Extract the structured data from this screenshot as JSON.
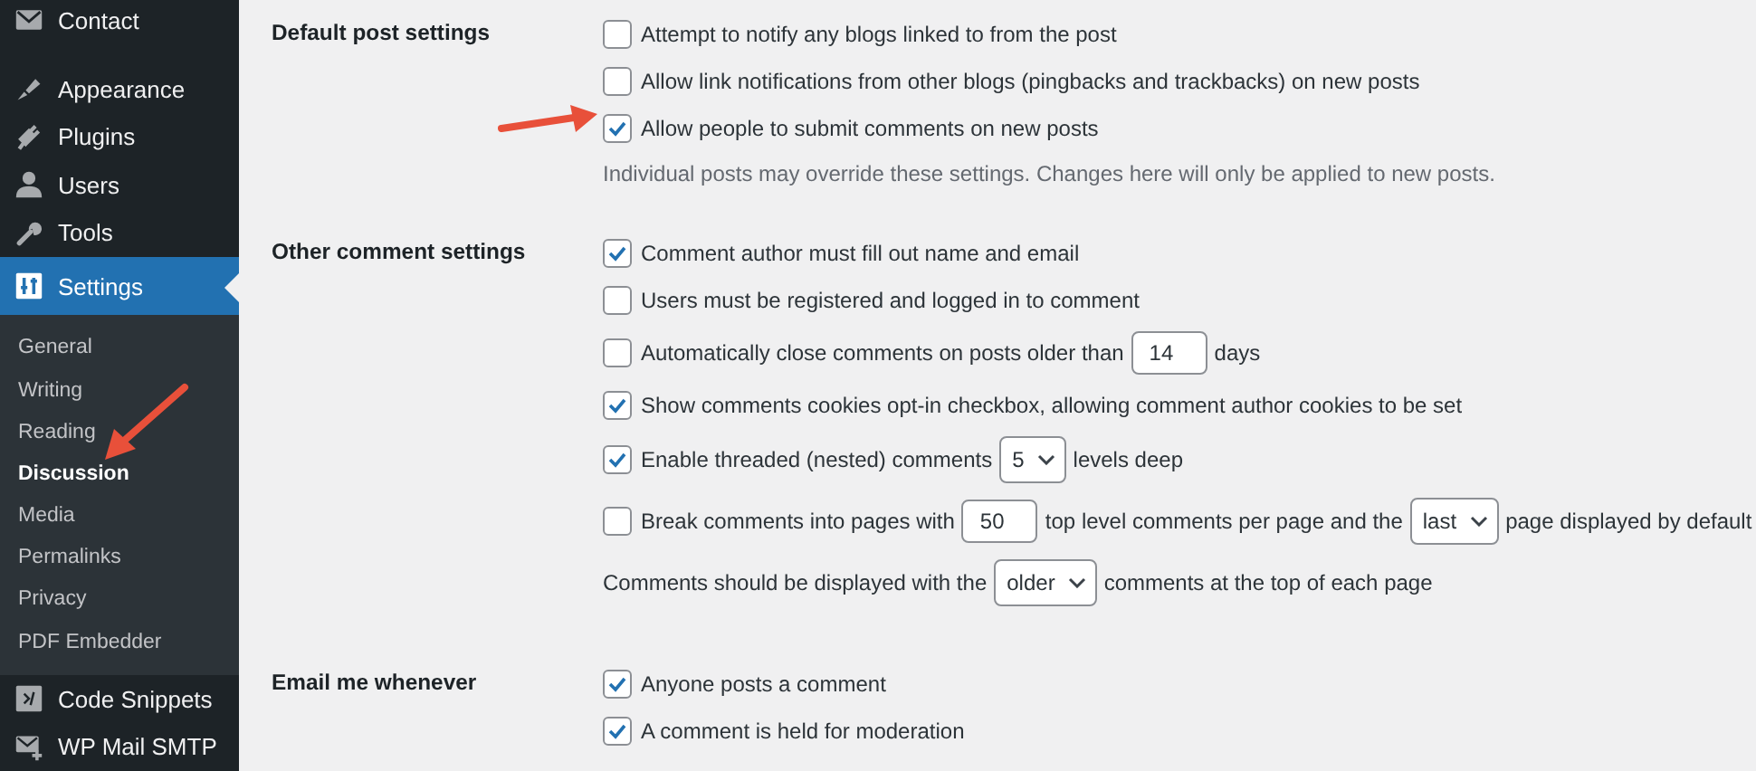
{
  "sidebar": {
    "items": [
      {
        "label": "Contact",
        "kind": "envelope",
        "selected": false
      },
      {
        "label": "Appearance",
        "kind": "brush",
        "selected": false
      },
      {
        "label": "Plugins",
        "kind": "plug",
        "selected": false
      },
      {
        "label": "Users",
        "kind": "user",
        "selected": false
      },
      {
        "label": "Tools",
        "kind": "wrench",
        "selected": false
      },
      {
        "label": "Settings",
        "kind": "sliders",
        "selected": true,
        "children": [
          {
            "label": "General",
            "selected": false
          },
          {
            "label": "Writing",
            "selected": false
          },
          {
            "label": "Reading",
            "selected": false
          },
          {
            "label": "Discussion",
            "selected": true
          },
          {
            "label": "Media",
            "selected": false
          },
          {
            "label": "Permalinks",
            "selected": false
          },
          {
            "label": "Privacy",
            "selected": false
          },
          {
            "label": "PDF Embedder",
            "selected": false
          }
        ]
      },
      {
        "label": "Code Snippets",
        "kind": "code",
        "selected": false
      },
      {
        "label": "WP Mail SMTP",
        "kind": "mail-plus",
        "selected": false
      }
    ]
  },
  "sections": [
    {
      "title": "Default post settings",
      "options": [
        {
          "kind": "checkbox",
          "checked": false,
          "parts": [
            {
              "kind": "text",
              "text": "Attempt to notify any blogs linked to from the post"
            }
          ]
        },
        {
          "kind": "checkbox",
          "checked": false,
          "parts": [
            {
              "kind": "text",
              "text": "Allow link notifications from other blogs (pingbacks and trackbacks) on new posts"
            }
          ]
        },
        {
          "kind": "checkbox",
          "checked": true,
          "pointer": true,
          "parts": [
            {
              "kind": "text",
              "text": "Allow people to submit comments on new posts"
            }
          ]
        },
        {
          "kind": "note",
          "parts": [
            {
              "kind": "text",
              "text": "Individual posts may override these settings. Changes here will only be applied to new posts."
            }
          ]
        }
      ]
    },
    {
      "title": "Other comment settings",
      "options": [
        {
          "kind": "checkbox",
          "checked": true,
          "parts": [
            {
              "kind": "text",
              "text": "Comment author must fill out name and email"
            }
          ]
        },
        {
          "kind": "checkbox",
          "checked": false,
          "parts": [
            {
              "kind": "text",
              "text": "Users must be registered and logged in to comment"
            }
          ]
        },
        {
          "kind": "checkbox",
          "checked": false,
          "parts": [
            {
              "kind": "text",
              "text": "Automatically close comments on posts older than"
            },
            {
              "kind": "input",
              "value": "14"
            },
            {
              "kind": "text",
              "text": "days"
            }
          ]
        },
        {
          "kind": "checkbox",
          "checked": true,
          "parts": [
            {
              "kind": "text",
              "text": "Show comments cookies opt-in checkbox, allowing comment author cookies to be set"
            }
          ]
        },
        {
          "kind": "checkbox",
          "checked": true,
          "parts": [
            {
              "kind": "text",
              "text": "Enable threaded (nested) comments"
            },
            {
              "kind": "select",
              "value": "5"
            },
            {
              "kind": "text",
              "text": "levels deep"
            }
          ]
        },
        {
          "kind": "checkbox",
          "checked": false,
          "parts": [
            {
              "kind": "text",
              "text": "Break comments into pages with"
            },
            {
              "kind": "input",
              "value": "50"
            },
            {
              "kind": "text",
              "text": "top level comments per page and the"
            },
            {
              "kind": "select",
              "value": "last"
            },
            {
              "kind": "text",
              "text": "page displayed by default"
            }
          ]
        },
        {
          "kind": "plain",
          "parts": [
            {
              "kind": "text",
              "text": "Comments should be displayed with the"
            },
            {
              "kind": "select",
              "value": "older"
            },
            {
              "kind": "text",
              "text": "comments at the top of each page"
            }
          ]
        }
      ]
    },
    {
      "title": "Email me whenever",
      "options": [
        {
          "kind": "checkbox",
          "checked": true,
          "parts": [
            {
              "kind": "text",
              "text": "Anyone posts a comment"
            }
          ]
        },
        {
          "kind": "checkbox",
          "checked": true,
          "parts": [
            {
              "kind": "text",
              "text": "A comment is held for moderation"
            }
          ]
        }
      ]
    }
  ]
}
